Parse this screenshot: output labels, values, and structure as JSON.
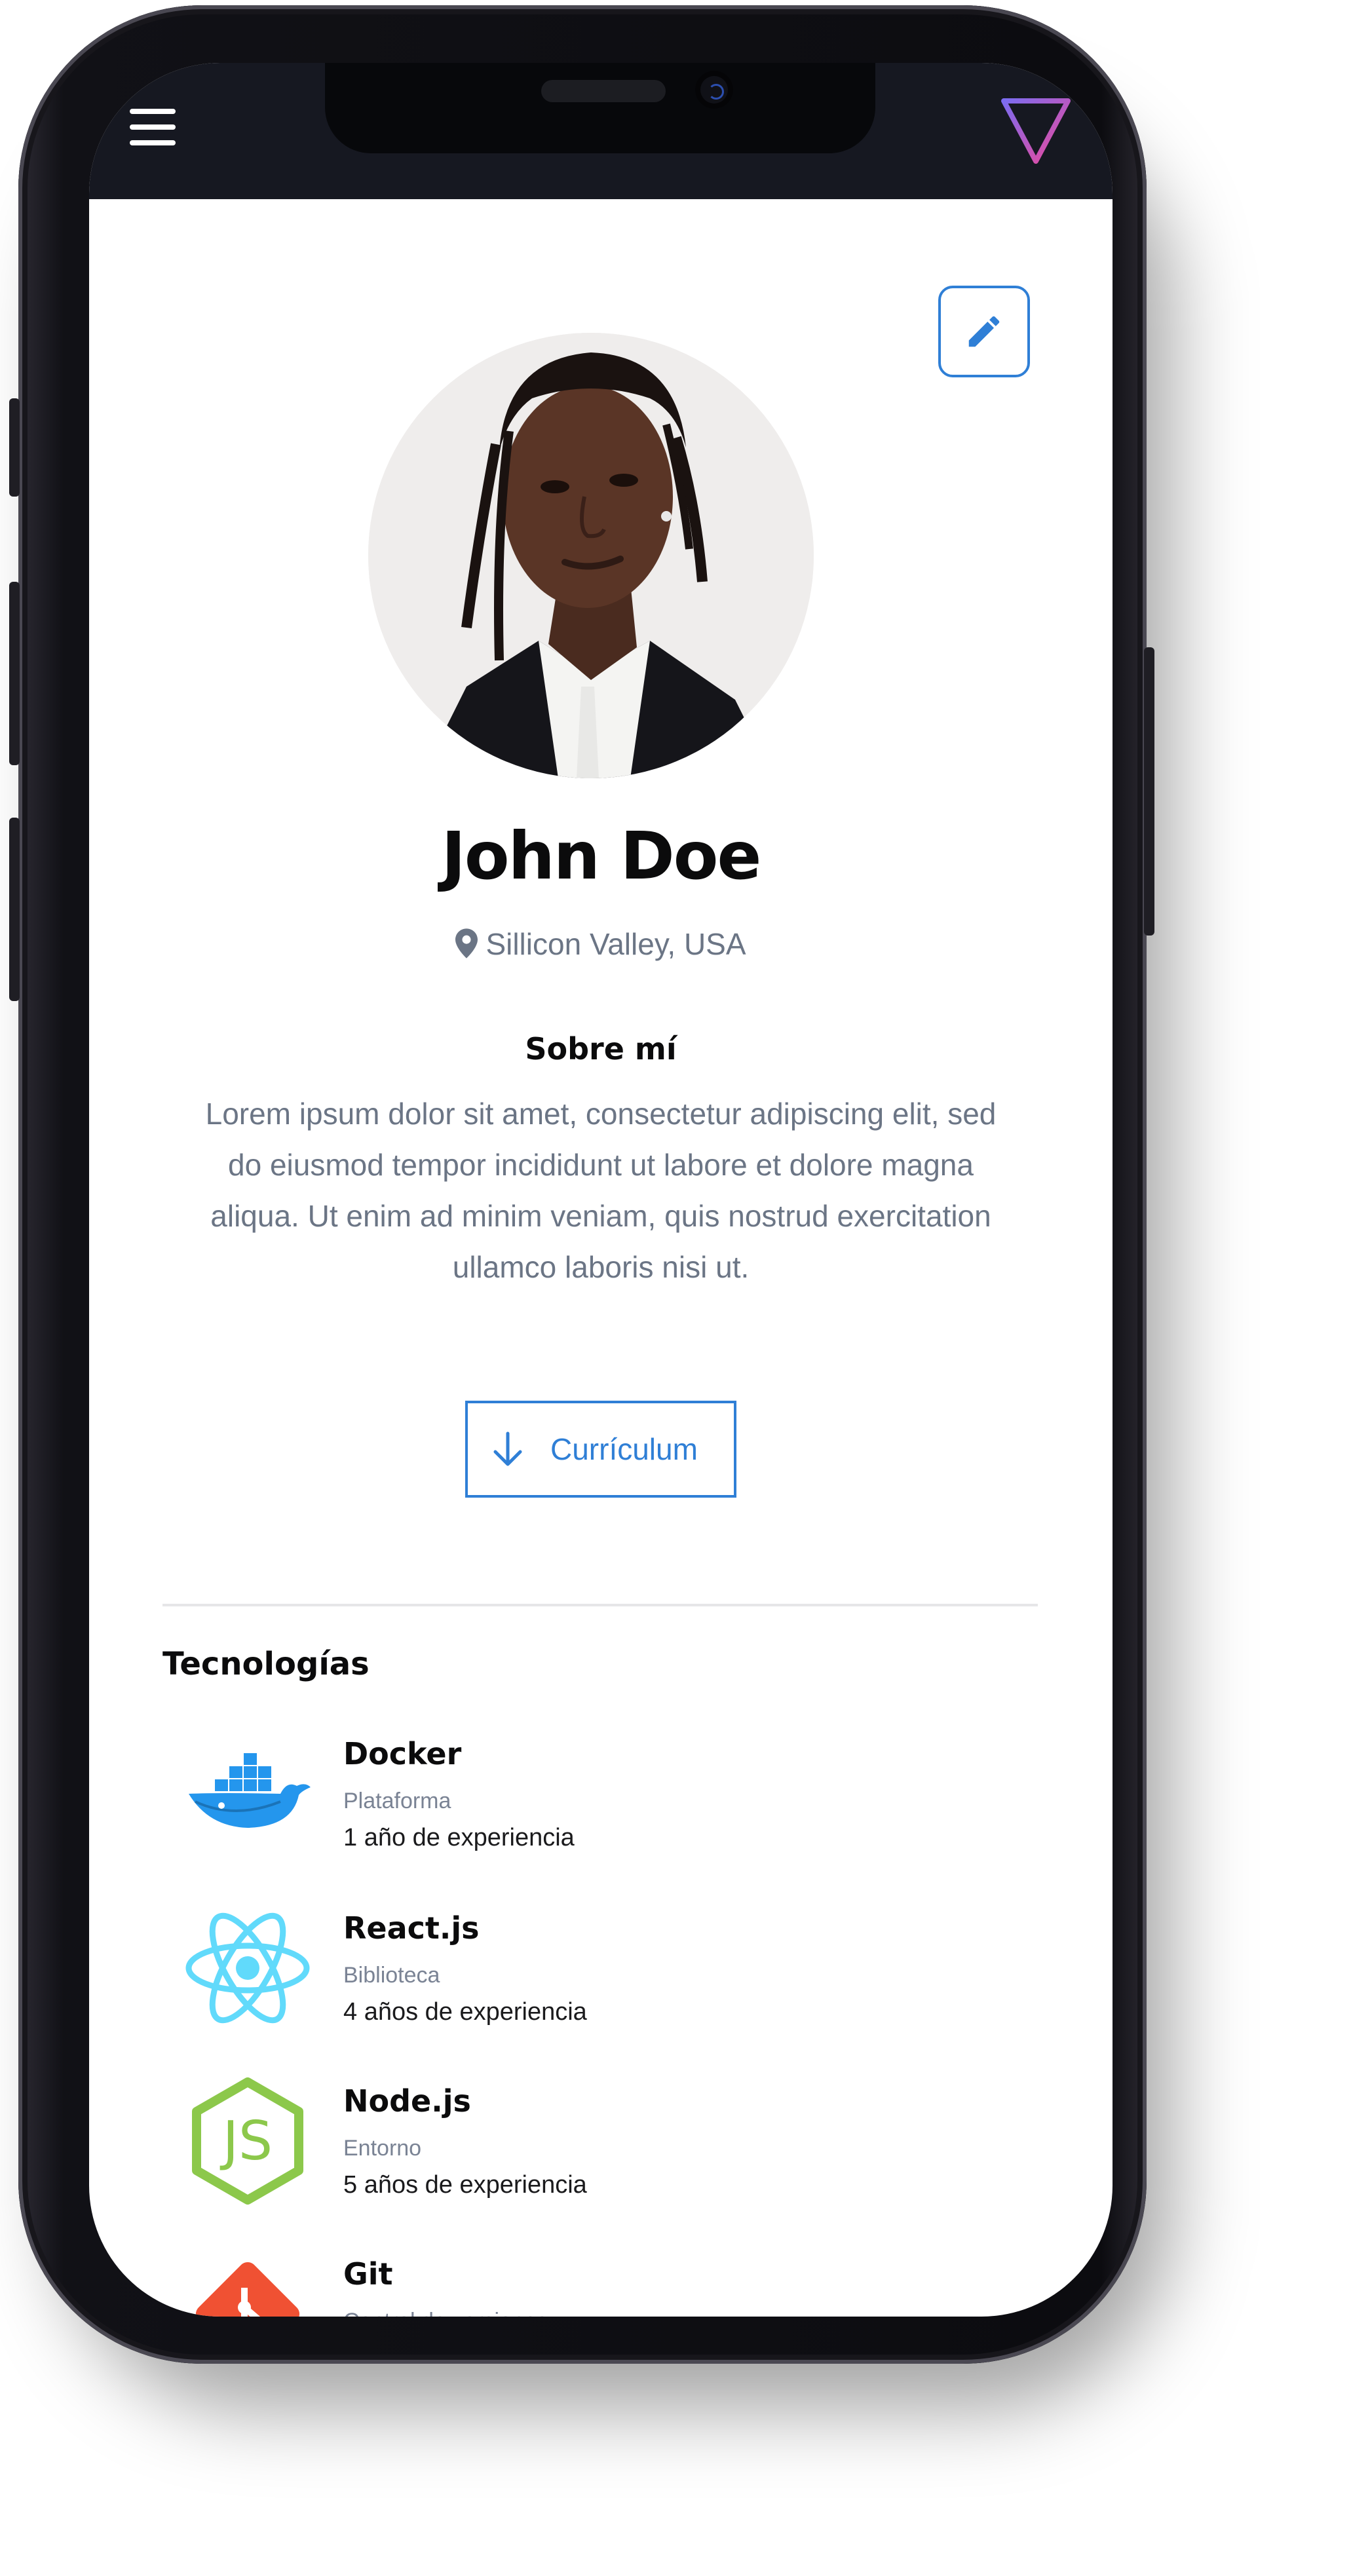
{
  "header": {
    "menu_icon": "hamburger-menu-icon",
    "logo_icon": "triangle-logo-icon",
    "logo_colors": [
      "#8a5cf6",
      "#ec4899"
    ]
  },
  "profile": {
    "edit_icon": "pencil-icon",
    "name": "John Doe",
    "location_icon": "map-pin-icon",
    "location": "Sillicon Valley, USA",
    "about_title": "Sobre mí",
    "about_text": "Lorem ipsum dolor sit amet, consectetur adipiscing elit, sed do eiusmod tempor incididunt ut labore et dolore magna aliqua. Ut enim ad minim veniam, quis nostrud exercitation ullamco laboris nisi ut.",
    "cv_icon": "arrow-down-icon",
    "cv_label": "Currículum"
  },
  "technologies": {
    "title": "Tecnologías",
    "items": [
      {
        "name": "Docker",
        "type": "Plataforma",
        "experience": "1 año de experiencia",
        "icon": "docker-icon"
      },
      {
        "name": "React.js",
        "type": "Biblioteca",
        "experience": "4 años de experiencia",
        "icon": "react-icon"
      },
      {
        "name": "Node.js",
        "type": "Entorno",
        "experience": "5 años de experiencia",
        "icon": "nodejs-icon"
      },
      {
        "name": "Git",
        "type": "Control de versiones",
        "experience": "",
        "icon": "git-icon"
      }
    ]
  },
  "colors": {
    "accent": "#2f7fd6",
    "header_bg": "#161821",
    "muted_text": "#6b7585"
  }
}
